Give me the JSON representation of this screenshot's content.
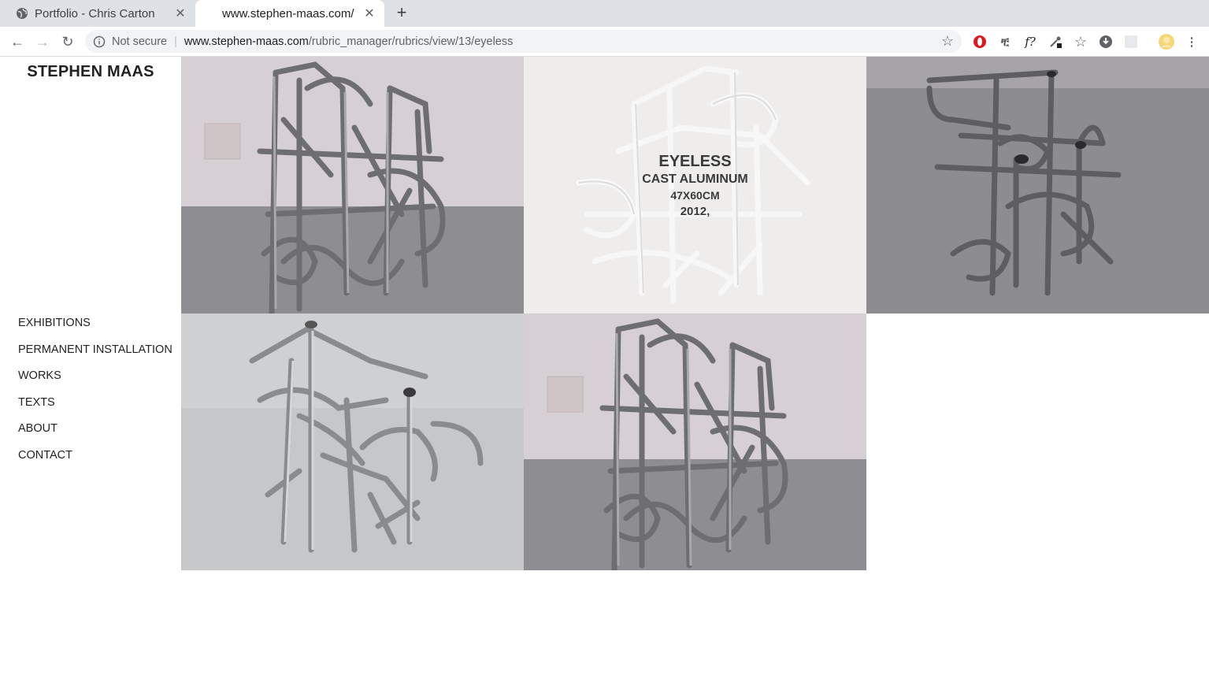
{
  "browser": {
    "tabs": [
      {
        "title": "Portfolio - Chris Carton",
        "active": false,
        "icon": "globe-icon"
      },
      {
        "title": "www.stephen-maas.com/",
        "active": true
      }
    ],
    "address": {
      "security_label": "Not secure",
      "host": "www.stephen-maas.com",
      "path": "/rubric_manager/rubrics/view/13/eyeless"
    }
  },
  "site": {
    "logo": "STEPHEN MAAS",
    "nav": [
      "EXHIBITIONS",
      "PERMANENT INSTALLATION",
      "WORKS",
      "TEXTS",
      "ABOUT",
      "CONTACT"
    ]
  },
  "artwork": {
    "title": "EYELESS",
    "medium": "CAST ALUMINUM",
    "dimensions": "47X60CM",
    "year": "2012,"
  },
  "gallery": {
    "images": [
      "sculpture-front-view",
      "sculpture-white-view",
      "sculpture-top-view-grey-floor",
      "sculpture-top-view-light-floor",
      "sculpture-front-view-2"
    ]
  }
}
